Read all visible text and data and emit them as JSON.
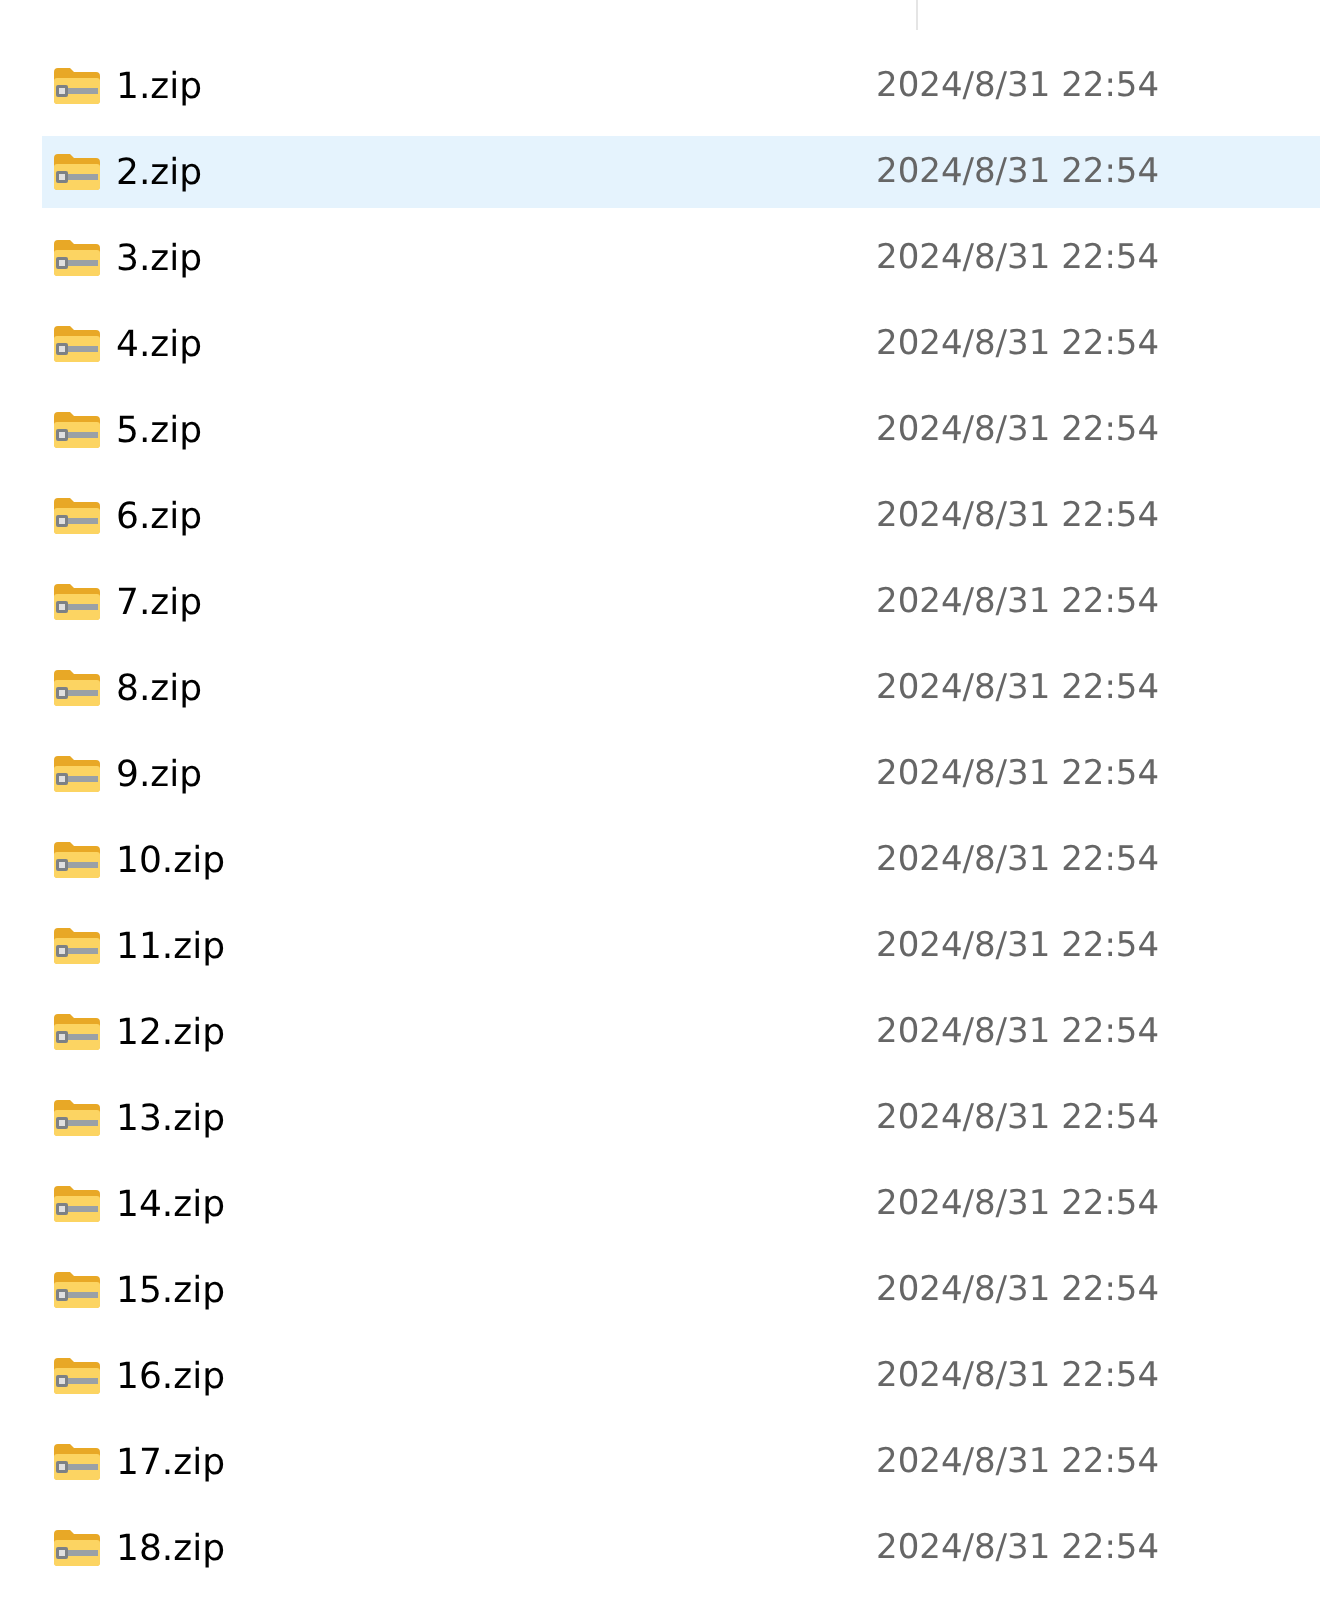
{
  "files": [
    {
      "name": "1.zip",
      "modified": "2024/8/31 22:54",
      "selected": false
    },
    {
      "name": "2.zip",
      "modified": "2024/8/31 22:54",
      "selected": true
    },
    {
      "name": "3.zip",
      "modified": "2024/8/31 22:54",
      "selected": false
    },
    {
      "name": "4.zip",
      "modified": "2024/8/31 22:54",
      "selected": false
    },
    {
      "name": "5.zip",
      "modified": "2024/8/31 22:54",
      "selected": false
    },
    {
      "name": "6.zip",
      "modified": "2024/8/31 22:54",
      "selected": false
    },
    {
      "name": "7.zip",
      "modified": "2024/8/31 22:54",
      "selected": false
    },
    {
      "name": "8.zip",
      "modified": "2024/8/31 22:54",
      "selected": false
    },
    {
      "name": "9.zip",
      "modified": "2024/8/31 22:54",
      "selected": false
    },
    {
      "name": "10.zip",
      "modified": "2024/8/31 22:54",
      "selected": false
    },
    {
      "name": "11.zip",
      "modified": "2024/8/31 22:54",
      "selected": false
    },
    {
      "name": "12.zip",
      "modified": "2024/8/31 22:54",
      "selected": false
    },
    {
      "name": "13.zip",
      "modified": "2024/8/31 22:54",
      "selected": false
    },
    {
      "name": "14.zip",
      "modified": "2024/8/31 22:54",
      "selected": false
    },
    {
      "name": "15.zip",
      "modified": "2024/8/31 22:54",
      "selected": false
    },
    {
      "name": "16.zip",
      "modified": "2024/8/31 22:54",
      "selected": false
    },
    {
      "name": "17.zip",
      "modified": "2024/8/31 22:54",
      "selected": false
    },
    {
      "name": "18.zip",
      "modified": "2024/8/31 22:54",
      "selected": false
    }
  ]
}
